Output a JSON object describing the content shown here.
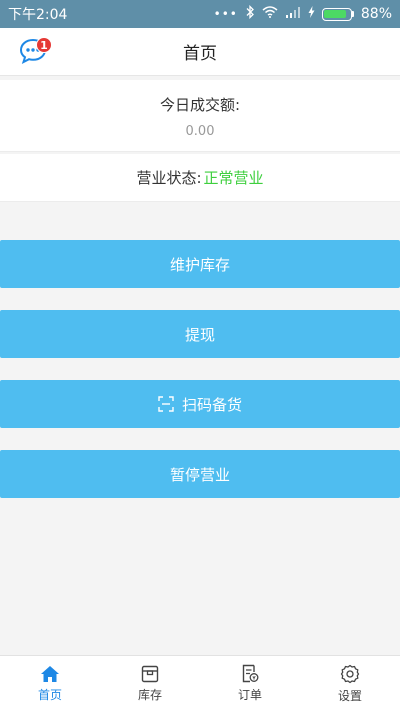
{
  "status_bar": {
    "time": "下午2:04",
    "dots": "•••",
    "battery_percent": "88%",
    "battery_level": 0.88
  },
  "header": {
    "title": "首页",
    "message_badge": "1"
  },
  "turnover": {
    "label": "今日成交额:",
    "value": "0.00"
  },
  "business_status": {
    "label": "营业状态:",
    "value": "正常营业",
    "value_color": "#3ecf3e"
  },
  "actions": {
    "maintain_stock": "维护库存",
    "withdraw": "提现",
    "scan_stock": "扫码备货",
    "pause_business": "暂停营业",
    "button_color": "#4fbdf0"
  },
  "tabs": [
    {
      "label": "首页",
      "icon": "home-icon",
      "active": true
    },
    {
      "label": "库存",
      "icon": "box-icon",
      "active": false
    },
    {
      "label": "订单",
      "icon": "order-icon",
      "active": false
    },
    {
      "label": "设置",
      "icon": "gear-icon",
      "active": false
    }
  ],
  "colors": {
    "accent": "#1e88e5",
    "status_bar": "#5f8fa8",
    "badge": "#e53935"
  }
}
